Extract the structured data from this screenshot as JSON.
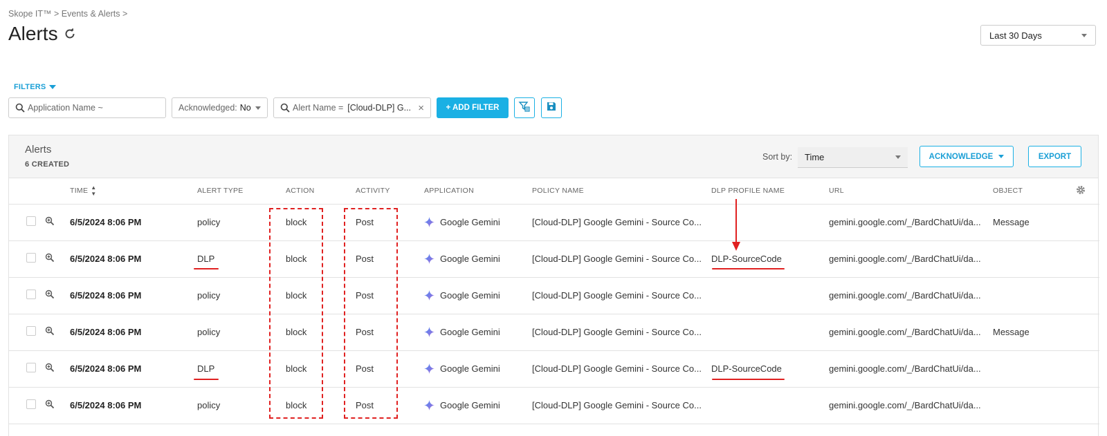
{
  "breadcrumb": "Skope IT™ > Events & Alerts >",
  "page_title": "Alerts",
  "range_select": "Last 30 Days",
  "filters_label": "FILTERS",
  "filters": {
    "application": "Application Name ~",
    "ack_label": "Acknowledged:",
    "ack_value": "No",
    "alert_label": "Alert Name =",
    "alert_value": "[Cloud-DLP] G...",
    "close": "×"
  },
  "add_filter_label": "+ ADD FILTER",
  "panel": {
    "title": "Alerts",
    "count": "6 CREATED",
    "sort_label": "Sort by:",
    "sort_value": "Time",
    "acknowledge_label": "ACKNOWLEDGE",
    "export_label": "EXPORT"
  },
  "columns": {
    "time": "TIME",
    "alert_type": "ALERT TYPE",
    "action": "ACTION",
    "activity": "ACTIVITY",
    "application": "APPLICATION",
    "policy": "POLICY NAME",
    "dlp_profile": "DLP PROFILE NAME",
    "url": "URL",
    "object": "OBJECT"
  },
  "rows": [
    {
      "time": "6/5/2024 8:06 PM",
      "alert_type": "policy",
      "action": "block",
      "activity": "Post",
      "application": "Google Gemini",
      "policy": "[Cloud-DLP] Google Gemini - Source Co...",
      "dlp_profile": "",
      "url": "gemini.google.com/_/BardChatUi/da...",
      "object": "Message"
    },
    {
      "time": "6/5/2024 8:06 PM",
      "alert_type": "DLP",
      "action": "block",
      "activity": "Post",
      "application": "Google Gemini",
      "policy": "[Cloud-DLP] Google Gemini - Source Co...",
      "dlp_profile": "DLP-SourceCode",
      "url": "gemini.google.com/_/BardChatUi/da...",
      "object": ""
    },
    {
      "time": "6/5/2024 8:06 PM",
      "alert_type": "policy",
      "action": "block",
      "activity": "Post",
      "application": "Google Gemini",
      "policy": "[Cloud-DLP] Google Gemini - Source Co...",
      "dlp_profile": "",
      "url": "gemini.google.com/_/BardChatUi/da...",
      "object": ""
    },
    {
      "time": "6/5/2024 8:06 PM",
      "alert_type": "policy",
      "action": "block",
      "activity": "Post",
      "application": "Google Gemini",
      "policy": "[Cloud-DLP] Google Gemini - Source Co...",
      "dlp_profile": "",
      "url": "gemini.google.com/_/BardChatUi/da...",
      "object": "Message"
    },
    {
      "time": "6/5/2024 8:06 PM",
      "alert_type": "DLP",
      "action": "block",
      "activity": "Post",
      "application": "Google Gemini",
      "policy": "[Cloud-DLP] Google Gemini - Source Co...",
      "dlp_profile": "DLP-SourceCode",
      "url": "gemini.google.com/_/BardChatUi/da...",
      "object": ""
    },
    {
      "time": "6/5/2024 8:06 PM",
      "alert_type": "policy",
      "action": "block",
      "activity": "Post",
      "application": "Google Gemini",
      "policy": "[Cloud-DLP] Google Gemini - Source Co...",
      "dlp_profile": "",
      "url": "gemini.google.com/_/BardChatUi/da...",
      "object": ""
    }
  ],
  "colors": {
    "accent": "#1ab0e4",
    "annotation": "#e02020"
  },
  "icons": [
    "refresh-icon",
    "search-icon",
    "filter-config-icon",
    "save-icon",
    "zoom-icon",
    "gemini-icon",
    "gear-icon"
  ]
}
